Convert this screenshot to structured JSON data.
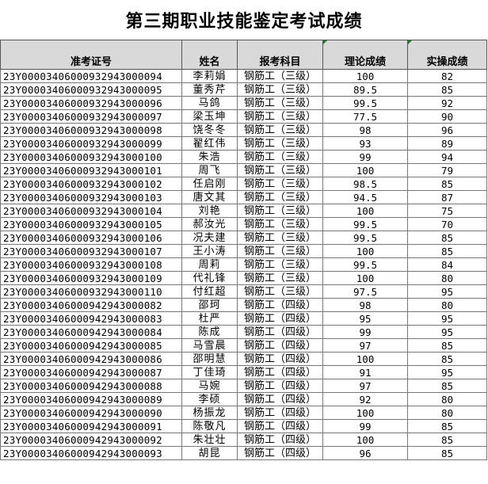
{
  "title": "第三期职业技能鉴定考试成绩",
  "columns": {
    "id": "准考证号",
    "name": "姓名",
    "subject": "报考科目",
    "theory": "理论成绩",
    "practice": "实操成绩"
  },
  "rows": [
    {
      "id": "23Y00003406000932943000094",
      "name": "李莉娟",
      "subject": "钢筋工（三级）",
      "theory": "100",
      "practice": "82"
    },
    {
      "id": "23Y00003406000932943000095",
      "name": "董秀芹",
      "subject": "钢筋工（三级）",
      "theory": "89.5",
      "practice": "85"
    },
    {
      "id": "23Y00003406000932943000096",
      "name": "马鸽",
      "subject": "钢筋工（三级）",
      "theory": "99.5",
      "practice": "92"
    },
    {
      "id": "23Y00003406000932943000097",
      "name": "梁玉坤",
      "subject": "钢筋工（三级）",
      "theory": "77.5",
      "practice": "90"
    },
    {
      "id": "23Y00003406000932943000098",
      "name": "饶冬冬",
      "subject": "钢筋工（三级）",
      "theory": "98",
      "practice": "96"
    },
    {
      "id": "23Y00003406000932943000099",
      "name": "翟红伟",
      "subject": "钢筋工（三级）",
      "theory": "93",
      "practice": "89"
    },
    {
      "id": "23Y00003406000932943000100",
      "name": "朱浩",
      "subject": "钢筋工（三级）",
      "theory": "99",
      "practice": "94"
    },
    {
      "id": "23Y00003406000932943000101",
      "name": "周飞",
      "subject": "钢筋工（三级）",
      "theory": "100",
      "practice": "79"
    },
    {
      "id": "23Y00003406000932943000102",
      "name": "任启刚",
      "subject": "钢筋工（三级）",
      "theory": "98.5",
      "practice": "85"
    },
    {
      "id": "23Y00003406000932943000103",
      "name": "唐文其",
      "subject": "钢筋工（三级）",
      "theory": "94.5",
      "practice": "87"
    },
    {
      "id": "23Y00003406000932943000104",
      "name": "刘艳",
      "subject": "钢筋工（三级）",
      "theory": "100",
      "practice": "75"
    },
    {
      "id": "23Y00003406000932943000105",
      "name": "郝汝光",
      "subject": "钢筋工（三级）",
      "theory": "99.5",
      "practice": "70"
    },
    {
      "id": "23Y00003406000932943000106",
      "name": "况夫建",
      "subject": "钢筋工（三级）",
      "theory": "99.5",
      "practice": "85"
    },
    {
      "id": "23Y00003406000932943000107",
      "name": "王小涛",
      "subject": "钢筋工（三级）",
      "theory": "100",
      "practice": "85"
    },
    {
      "id": "23Y00003406000932943000108",
      "name": "周莉",
      "subject": "钢筋工（三级）",
      "theory": "99.5",
      "practice": "84"
    },
    {
      "id": "23Y00003406000932943000109",
      "name": "代礼锋",
      "subject": "钢筋工（三级）",
      "theory": "100",
      "practice": "80"
    },
    {
      "id": "23Y00003406000932943000110",
      "name": "付红超",
      "subject": "钢筋工（三级）",
      "theory": "97.5",
      "practice": "95"
    },
    {
      "id": "23Y00003406000942943000082",
      "name": "邵珂",
      "subject": "钢筋工（四级）",
      "theory": "98",
      "practice": "80"
    },
    {
      "id": "23Y00003406000942943000083",
      "name": "杜严",
      "subject": "钢筋工（四级）",
      "theory": "95",
      "practice": "95"
    },
    {
      "id": "23Y00003406000942943000084",
      "name": "陈成",
      "subject": "钢筋工（四级）",
      "theory": "99",
      "practice": "95"
    },
    {
      "id": "23Y00003406000942943000085",
      "name": "马雪晨",
      "subject": "钢筋工（四级）",
      "theory": "97",
      "practice": "85"
    },
    {
      "id": "23Y00003406000942943000086",
      "name": "邵明慧",
      "subject": "钢筋工（四级）",
      "theory": "100",
      "practice": "85"
    },
    {
      "id": "23Y00003406000942943000087",
      "name": "丁佳琦",
      "subject": "钢筋工（四级）",
      "theory": "91",
      "practice": "95"
    },
    {
      "id": "23Y00003406000942943000088",
      "name": "马婉",
      "subject": "钢筋工（四级）",
      "theory": "97",
      "practice": "85"
    },
    {
      "id": "23Y00003406000942943000089",
      "name": "李硕",
      "subject": "钢筋工（四级）",
      "theory": "92",
      "practice": "80"
    },
    {
      "id": "23Y00003406000942943000090",
      "name": "杨振龙",
      "subject": "钢筋工（四级）",
      "theory": "100",
      "practice": "80"
    },
    {
      "id": "23Y00003406000942943000091",
      "name": "陈敬凡",
      "subject": "钢筋工（四级）",
      "theory": "99",
      "practice": "85"
    },
    {
      "id": "23Y00003406000942943000092",
      "name": "朱壮壮",
      "subject": "钢筋工（四级）",
      "theory": "100",
      "practice": "85"
    },
    {
      "id": "23Y00003406000942943000093",
      "name": "胡昆",
      "subject": "钢筋工（四级）",
      "theory": "96",
      "practice": "85"
    }
  ]
}
